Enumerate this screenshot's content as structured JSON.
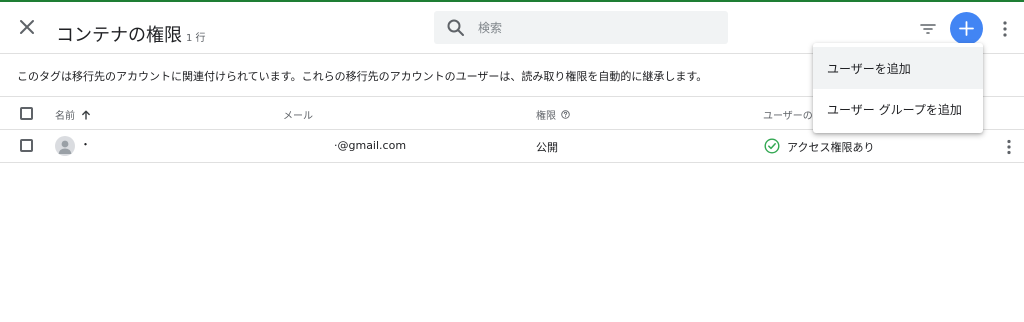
{
  "header": {
    "title": "コンテナの権限",
    "count": "1 行",
    "search_placeholder": "検索"
  },
  "info_text": "このタグは移行先のアカウントに関連付けられています。これらの移行先のアカウントのユーザーは、読み取り権限を自動的に継承します。",
  "table": {
    "columns": [
      "名前",
      "メール",
      "権限",
      "ユーザーの"
    ],
    "rows": [
      {
        "name": "・",
        "email": "·@gmail.com",
        "permission": "公開",
        "user_access": "アクセス権限あり"
      }
    ]
  },
  "menu": {
    "items": [
      "ユーザーを追加",
      "ユーザー グループを追加"
    ]
  },
  "colors": {
    "accent": "#4285f4",
    "success": "#34a853"
  }
}
